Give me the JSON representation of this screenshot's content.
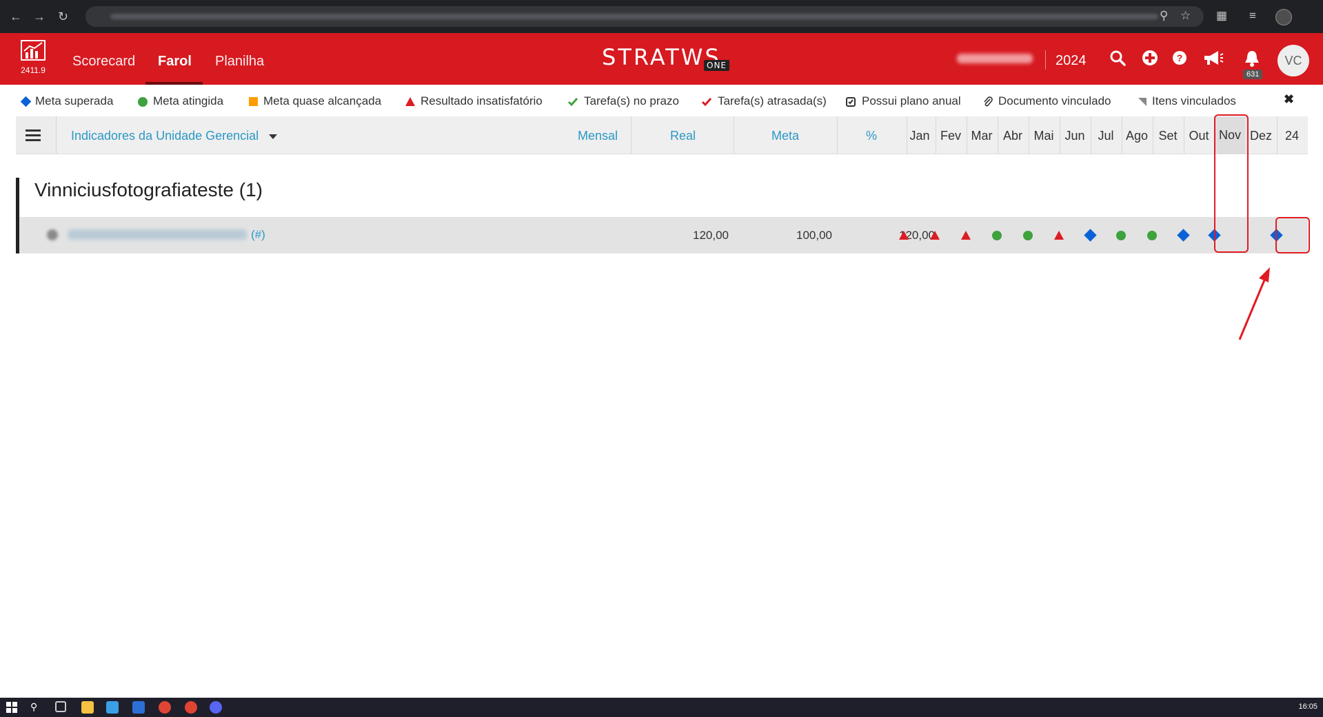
{
  "app": {
    "version": "2411.9",
    "nav_tabs": [
      {
        "label": "Scorecard",
        "active": false
      },
      {
        "label": "Farol",
        "active": true
      },
      {
        "label": "Planilha",
        "active": false
      }
    ],
    "brand": "STRATWS",
    "brand_suffix": "ONE",
    "year": "2024",
    "notifications_count": "631",
    "user_initials": "VC",
    "accent_color": "#d71920"
  },
  "legend": [
    {
      "label": "Meta superada",
      "symbol": "diamond-blue"
    },
    {
      "label": "Meta atingida",
      "symbol": "circle-green"
    },
    {
      "label": "Meta quase alcançada",
      "symbol": "square-orange"
    },
    {
      "label": "Resultado insatisfatório",
      "symbol": "triangle-red"
    },
    {
      "label": "Tarefa(s) no prazo",
      "symbol": "check-green"
    },
    {
      "label": "Tarefa(s) atrasada(s)",
      "symbol": "check-red"
    },
    {
      "label": "Possui plano anual",
      "symbol": "calendar-check-icon"
    },
    {
      "label": "Documento vinculado",
      "symbol": "paperclip-icon"
    },
    {
      "label": "Itens vinculados",
      "symbol": "corner-flag-icon"
    }
  ],
  "table": {
    "dropdown_label": "Indicadores da Unidade Gerencial",
    "periodicity": "Mensal",
    "col_real": "Real",
    "col_meta": "Meta",
    "col_pct": "%",
    "months": [
      "Jan",
      "Fev",
      "Mar",
      "Abr",
      "Mai",
      "Jun",
      "Jul",
      "Ago",
      "Set",
      "Out",
      "Nov",
      "Dez",
      "24"
    ]
  },
  "group": {
    "title": "Vinniciusfotografiateste (1)",
    "rows": [
      {
        "hash": "(#)",
        "real": "120,00",
        "meta": "100,00",
        "pct": "120,00",
        "statuses": [
          "triangle",
          "triangle",
          "triangle",
          "circle",
          "circle",
          "triangle",
          "diamond",
          "circle",
          "circle",
          "diamond",
          "diamond",
          "",
          "diamond"
        ]
      }
    ]
  },
  "taskbar": {
    "time": "16:05"
  }
}
